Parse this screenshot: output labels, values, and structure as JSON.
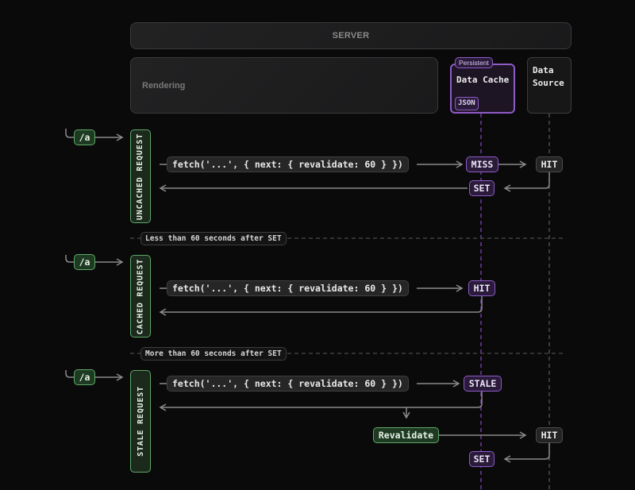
{
  "header": {
    "server_label": "SERVER",
    "rendering_label": "Rendering"
  },
  "data_cache": {
    "badge": "Persistent",
    "title": "Data Cache",
    "format_tag": "JSON",
    "color": "#8e5bc7"
  },
  "data_source": {
    "title_line1": "Data",
    "title_line2": "Source"
  },
  "sections": [
    {
      "route": "/a",
      "label": "UNCACHED REQUEST",
      "fetch_call": "fetch('...', { next: { revalidate: 60 } })",
      "cache_result": "MISS",
      "source_result": "HIT",
      "cache_action": "SET"
    },
    {
      "route": "/a",
      "label": "CACHED REQUEST",
      "fetch_call": "fetch('...', { next: { revalidate: 60 } })",
      "cache_result": "HIT"
    },
    {
      "route": "/a",
      "label": "STALE REQUEST",
      "fetch_call": "fetch('...', { next: { revalidate: 60 } })",
      "cache_result": "STALE",
      "revalidate_label": "Revalidate",
      "source_result": "HIT",
      "cache_action": "SET"
    }
  ],
  "dividers": [
    "Less than 60 seconds after SET",
    "More than 60 seconds after SET"
  ],
  "colors": {
    "background": "#0b0a0b",
    "request_green": "#5ea866",
    "cache_purple": "#8e5bc7",
    "line_gray": "#8a8a8a"
  }
}
